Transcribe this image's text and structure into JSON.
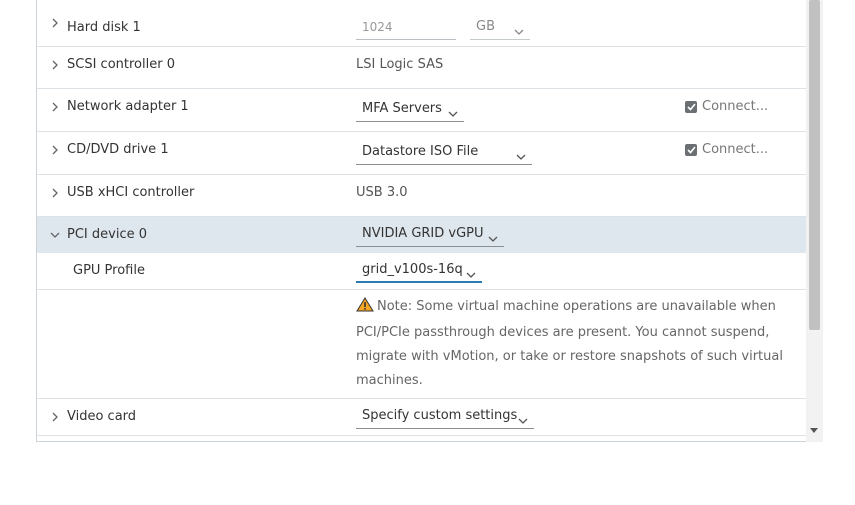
{
  "rows": {
    "hard_disk": {
      "label": "Hard disk 1",
      "size_value": "1024",
      "unit": "GB"
    },
    "scsi": {
      "label": "SCSI controller 0",
      "value": "LSI Logic SAS"
    },
    "network": {
      "label": "Network adapter 1",
      "network": "MFA Servers",
      "connect_label": "Connect..."
    },
    "cdrom": {
      "label": "CD/DVD drive 1",
      "media": "Datastore ISO File",
      "connect_label": "Connect..."
    },
    "usb": {
      "label": "USB xHCI controller",
      "value": "USB 3.0"
    },
    "pci": {
      "label": "PCI device 0",
      "device": "NVIDIA GRID vGPU"
    },
    "gpu_profile": {
      "label": "GPU Profile",
      "value": "grid_v100s-16q"
    },
    "note": {
      "text": "Note: Some virtual machine operations are unavailable when PCI/PCIe passthrough devices are present. You cannot suspend, migrate with vMotion, or take or restore snapshots of such virtual machines."
    },
    "video": {
      "label": "Video card",
      "value": "Specify custom settings"
    }
  },
  "icons": {
    "expand": "chevron-right-icon",
    "collapse": "chevron-down-icon",
    "warning": "warning-triangle-icon",
    "checkbox": "checkbox-checked-icon"
  },
  "colors": {
    "selected_row": "#dfe7ee",
    "focus_underline": "#2c7cb2",
    "warning": "#f5a623"
  }
}
